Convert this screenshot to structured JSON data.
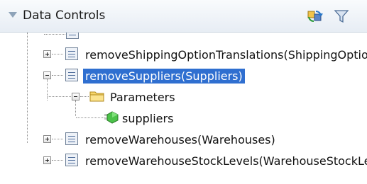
{
  "panel": {
    "title": "Data Controls"
  },
  "tree": {
    "items": [
      {
        "label": "removeShippingOptionTranslations(ShippingOptionTranslations)"
      },
      {
        "label": "removeSuppliers(Suppliers)"
      },
      {
        "label": "Parameters"
      },
      {
        "label": "suppliers"
      },
      {
        "label": "removeWarehouses(Warehouses)"
      },
      {
        "label": "removeWarehouseStockLevels(WarehouseStockLevels)"
      }
    ]
  },
  "colors": {
    "selection": "#2f6fd0",
    "header_bg": "#e7edf4"
  },
  "icons": [
    "collapse-triangle-icon",
    "refresh-icon",
    "filter-icon",
    "method-icon",
    "folder-icon",
    "bean-icon",
    "expand-icon",
    "collapse-icon"
  ]
}
